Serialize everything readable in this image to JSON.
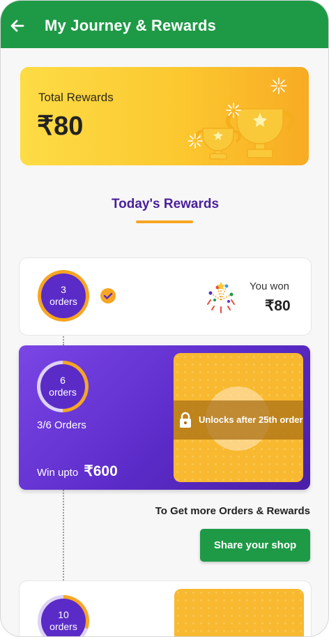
{
  "header": {
    "title": "My Journey & Rewards",
    "back_icon": "arrow-left-icon"
  },
  "total_rewards": {
    "label": "Total Rewards",
    "amount": "₹80"
  },
  "section": {
    "title": "Today's Rewards"
  },
  "milestones": [
    {
      "orders_count": "3",
      "orders_label": "orders",
      "status": "completed",
      "won_label": "You won",
      "won_amount": "₹80"
    },
    {
      "orders_count": "6",
      "orders_label": "orders",
      "progress_text": "3/6 Orders",
      "progress": 0.5,
      "win_label": "Win upto",
      "win_amount": "₹600",
      "lock_text": "Unlocks after 25th order"
    },
    {
      "orders_count": "10",
      "orders_label": "orders",
      "progress": 0.3
    }
  ],
  "cta": {
    "text": "To Get more Orders & Rewards",
    "button_label": "Share your shop"
  },
  "colors": {
    "header_green": "#1e9a47",
    "accent_orange": "#f6a623",
    "purple": "#5b2bc8",
    "gold": "#fcc830"
  }
}
